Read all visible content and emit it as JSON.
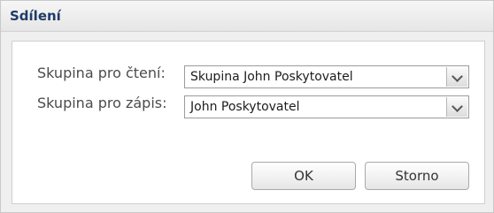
{
  "dialog": {
    "title": "Sdílení",
    "read_group": {
      "label": "Skupina pro čtení:",
      "value": "Skupina John Poskytovatel"
    },
    "write_group": {
      "label": "Skupina pro zápis:",
      "value": "John Poskytovatel"
    },
    "buttons": {
      "ok": "OK",
      "cancel": "Storno"
    }
  }
}
